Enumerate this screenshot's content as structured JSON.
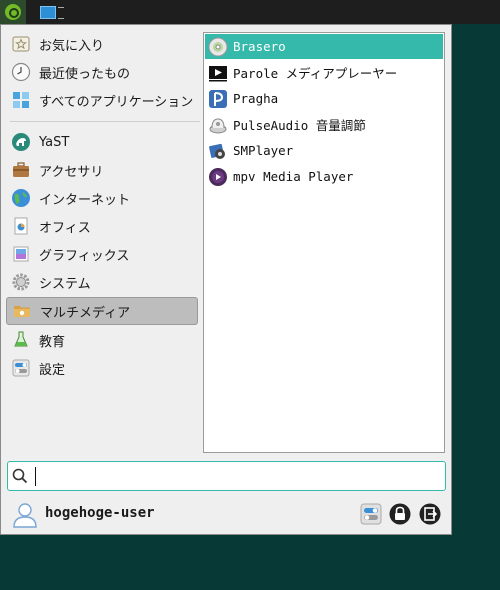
{
  "taskbar": {
    "start_icon": "opensuse-chameleon-icon",
    "task_icon": "window-icon"
  },
  "categories": [
    {
      "label": "お気に入り",
      "icon": "favorites-icon"
    },
    {
      "label": "最近使ったもの",
      "icon": "clock-icon"
    },
    {
      "label": "すべてのアプリケーション",
      "icon": "all-apps-icon"
    },
    {
      "label": "YaST",
      "icon": "yast-icon"
    },
    {
      "label": "アクセサリ",
      "icon": "briefcase-icon"
    },
    {
      "label": "インターネット",
      "icon": "globe-icon"
    },
    {
      "label": "オフィス",
      "icon": "office-icon"
    },
    {
      "label": "グラフィックス",
      "icon": "graphics-icon"
    },
    {
      "label": "システム",
      "icon": "gear-icon"
    },
    {
      "label": "マルチメディア",
      "icon": "multimedia-folder-icon"
    },
    {
      "label": "教育",
      "icon": "education-flask-icon"
    },
    {
      "label": "設定",
      "icon": "settings-toggle-icon"
    }
  ],
  "active_category": "マルチメディア",
  "apps": [
    {
      "label": "Brasero",
      "icon": "disc-icon"
    },
    {
      "label": "Parole メディアプレーヤー",
      "icon": "play-icon"
    },
    {
      "label": "Pragha",
      "icon": "pragha-icon"
    },
    {
      "label": "PulseAudio 音量調節",
      "icon": "speaker-icon"
    },
    {
      "label": "SMPlayer",
      "icon": "smplayer-icon"
    },
    {
      "label": "mpv Media Player",
      "icon": "mpv-icon"
    }
  ],
  "selected_app": "Brasero",
  "search": {
    "value": "",
    "placeholder": ""
  },
  "user": {
    "name": "hogehoge-user"
  },
  "actions": [
    {
      "name": "settings",
      "icon": "settings-toggle-icon"
    },
    {
      "name": "lock",
      "icon": "lock-icon"
    },
    {
      "name": "logout",
      "icon": "logout-icon"
    }
  ],
  "colors": {
    "accent": "#35b9ab",
    "desktop": "#073a36",
    "panel": "#1e1e1e"
  }
}
